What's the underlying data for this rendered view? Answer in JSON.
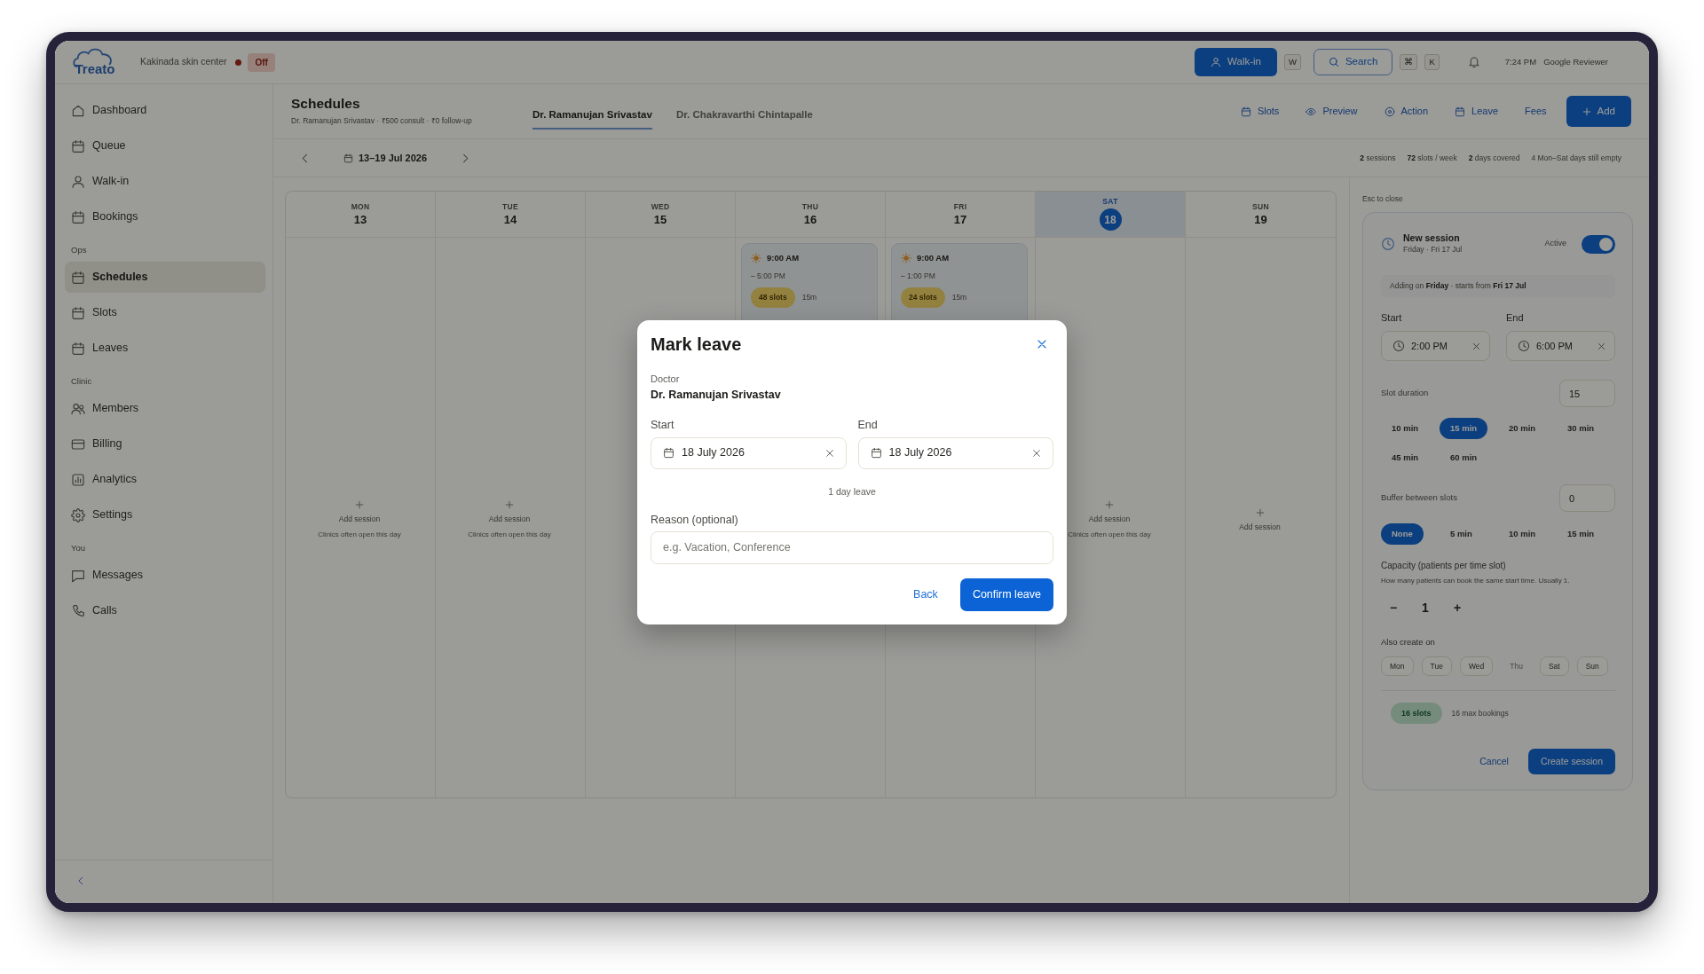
{
  "topbar": {
    "logo": "Treato",
    "clinic": "Kakinada skin center",
    "status": {
      "label": "Off",
      "on": false
    },
    "walk_in": {
      "label": "Walk-in",
      "shortcut": "W"
    },
    "search": {
      "label": "Search",
      "shortcut": [
        "⌘",
        "K"
      ]
    },
    "time": "7:24 PM",
    "user": "Google Reviewer"
  },
  "sidebar": {
    "groups": [
      {
        "items": [
          {
            "label": "Dashboard",
            "selected": false
          },
          {
            "label": "Queue",
            "selected": false
          },
          {
            "label": "Walk-in",
            "selected": false
          },
          {
            "label": "Bookings",
            "selected": false
          }
        ]
      },
      {
        "title": "Ops",
        "items": [
          {
            "label": "Schedules",
            "selected": true
          },
          {
            "label": "Slots",
            "selected": false
          },
          {
            "label": "Leaves",
            "selected": false
          }
        ]
      },
      {
        "title": "Clinic",
        "items": [
          {
            "label": "Members",
            "selected": false
          },
          {
            "label": "Billing",
            "selected": false
          },
          {
            "label": "Analytics",
            "selected": false
          },
          {
            "label": "Settings",
            "selected": false
          }
        ]
      },
      {
        "title": "You",
        "items": [
          {
            "label": "Messages",
            "selected": false
          },
          {
            "label": "Calls",
            "selected": false
          }
        ]
      }
    ]
  },
  "header": {
    "title": "Schedules",
    "subtitle": "Dr. Ramanujan Srivastav · ₹500 consult · ₹0 follow-up",
    "doctor_tabs": [
      {
        "label": "Dr. Ramanujan Srivastav",
        "selected": true
      },
      {
        "label": "Dr. Chakravarthi Chintapalle",
        "selected": false
      }
    ],
    "actions": [
      {
        "label": "Slots",
        "kind": "icon"
      },
      {
        "label": "Preview",
        "kind": "icon"
      },
      {
        "label": "Action",
        "kind": "icon"
      },
      {
        "label": "Leave",
        "kind": "icon"
      },
      {
        "label": "Fees",
        "kind": "plain"
      }
    ],
    "add_button": "Add"
  },
  "week": {
    "range": "13–19 Jul 2026",
    "stats": [
      "**2** sessions",
      "**72** slots / week",
      "**2** days covered",
      "4 Mon–Sat days still empty"
    ]
  },
  "calendar": {
    "days": [
      {
        "weekday": "MON",
        "date": "13",
        "today": false,
        "add": {
          "label": "Add session",
          "hint": "Clinics often open this day"
        }
      },
      {
        "weekday": "TUE",
        "date": "14",
        "today": false,
        "add": {
          "label": "Add session",
          "hint": "Clinics often open this day"
        }
      },
      {
        "weekday": "WED",
        "date": "15",
        "today": false
      },
      {
        "weekday": "THU",
        "date": "16",
        "today": false,
        "sessions": [
          {
            "start": "9:00 AM",
            "end": "– 5:00 PM",
            "slots": "48 slots",
            "duration": "15m"
          }
        ]
      },
      {
        "weekday": "FRI",
        "date": "17",
        "today": false,
        "sessions": [
          {
            "start": "9:00 AM",
            "end": "– 1:00 PM",
            "slots": "24 slots",
            "duration": "15m"
          }
        ]
      },
      {
        "weekday": "SAT",
        "date": "18",
        "today": true,
        "add": {
          "label": "Add session",
          "hint": "Clinics often open this day"
        }
      },
      {
        "weekday": "SUN",
        "date": "19",
        "today": false,
        "add": {
          "label": "Add session"
        }
      }
    ]
  },
  "session_panel": {
    "esc_hint": "Esc to close",
    "title": "New session",
    "subtitle": "Friday · Fri 17 Jul",
    "active": {
      "label": "Active",
      "on": true
    },
    "note": "Adding on **Friday** · starts from **Fri 17 Jul**",
    "start": {
      "label": "Start",
      "value": "2:00 PM"
    },
    "end": {
      "label": "End",
      "value": "6:00 PM"
    },
    "slot_duration": {
      "label": "Slot duration",
      "value": "15",
      "options": [
        {
          "label": "10 min",
          "selected": false
        },
        {
          "label": "15 min",
          "selected": true
        },
        {
          "label": "20 min",
          "selected": false
        },
        {
          "label": "30 min",
          "selected": false
        },
        {
          "label": "45 min",
          "selected": false
        },
        {
          "label": "60 min",
          "selected": false
        }
      ]
    },
    "buffer": {
      "label": "Buffer between slots",
      "value": "0",
      "options": [
        {
          "label": "None",
          "selected": true
        },
        {
          "label": "5 min",
          "selected": false
        },
        {
          "label": "10 min",
          "selected": false
        },
        {
          "label": "15 min",
          "selected": false
        }
      ]
    },
    "capacity": {
      "label": "Capacity (patients per time slot)",
      "hint": "How many patients can book the same start time. Usually 1.",
      "decrement": "−",
      "value": "1",
      "increment": "+"
    },
    "also_create": {
      "label": "Also create on",
      "days": [
        {
          "label": "Mon",
          "disabled": false
        },
        {
          "label": "Tue",
          "disabled": false
        },
        {
          "label": "Wed",
          "disabled": false
        },
        {
          "label": "Thu",
          "disabled": true
        },
        {
          "label": "Sat",
          "disabled": false
        },
        {
          "label": "Sun",
          "disabled": false
        }
      ]
    },
    "summary": {
      "slots": "16 slots",
      "bookings": "16 max bookings"
    },
    "cancel": "Cancel",
    "submit": "Create session"
  },
  "leave_dialog": {
    "title": "Mark leave",
    "doctor": {
      "label": "Doctor",
      "name": "Dr. Ramanujan Srivastav"
    },
    "start": {
      "label": "Start",
      "value": "18 July 2026"
    },
    "end": {
      "label": "End",
      "value": "18 July 2026"
    },
    "duration": "1 day leave",
    "reason": {
      "label": "Reason (optional)",
      "placeholder": "e.g. Vacation, Conference"
    },
    "back": "Back",
    "confirm": "Confirm leave"
  }
}
